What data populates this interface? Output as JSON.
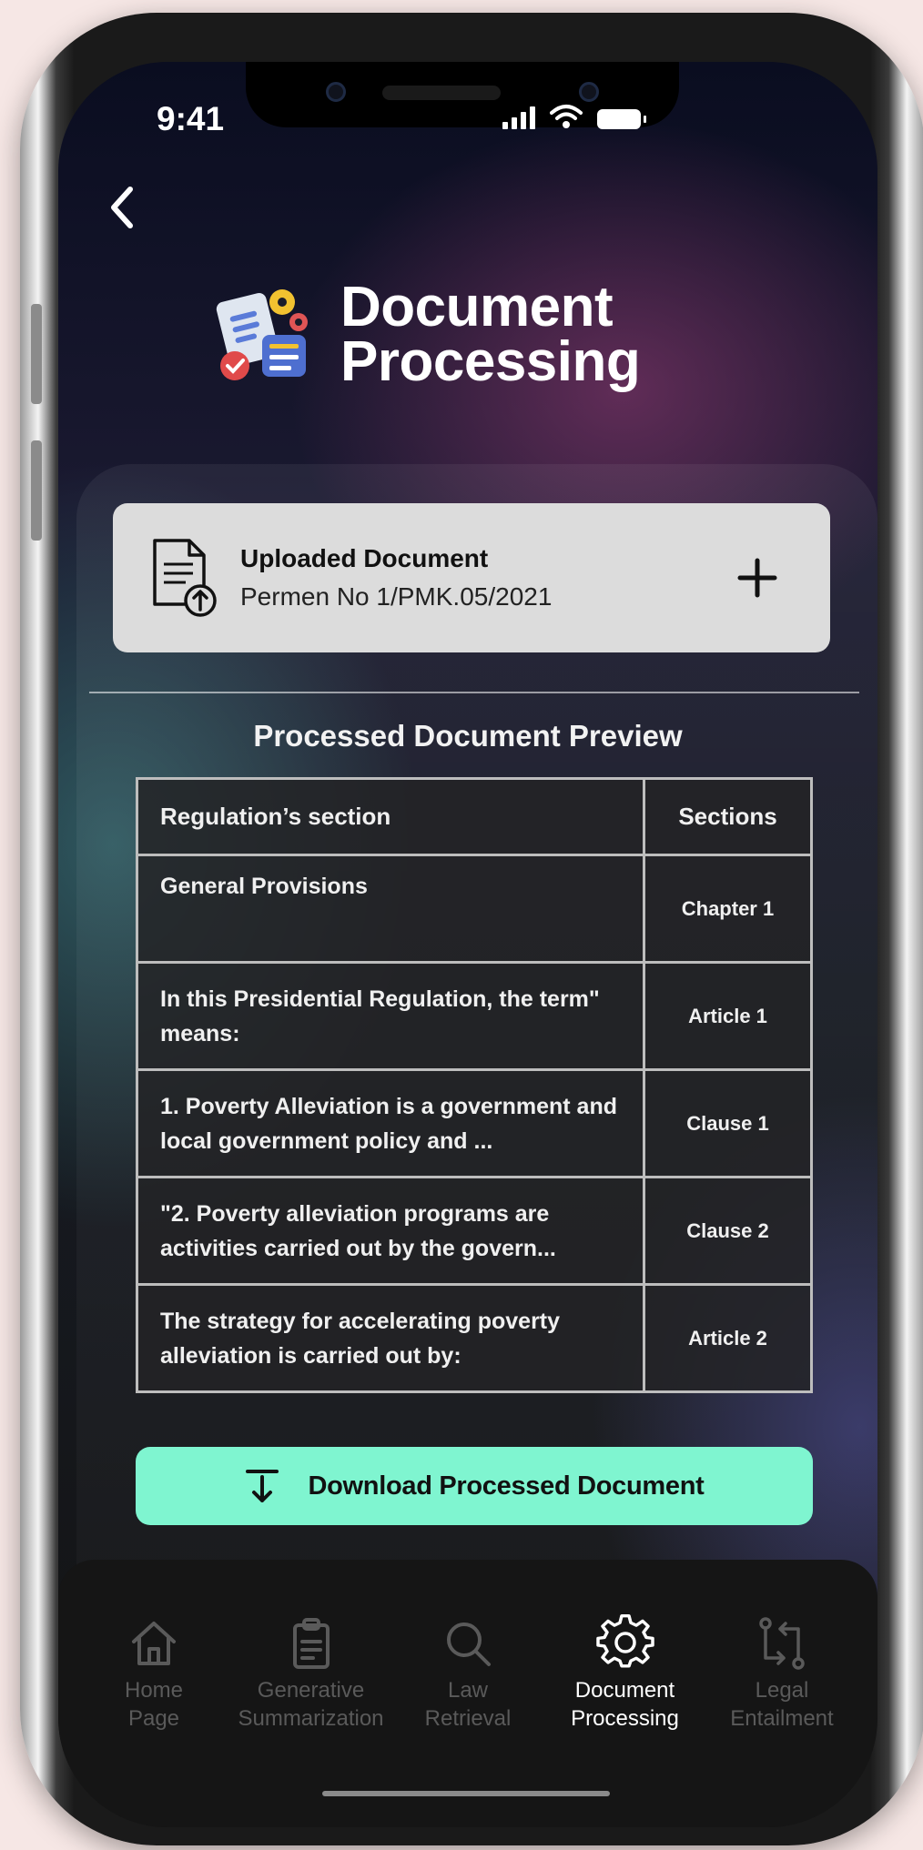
{
  "status_bar": {
    "time": "9:41"
  },
  "header": {
    "title_line1": "Document",
    "title_line2": "Processing"
  },
  "upload": {
    "title": "Uploaded Document",
    "document_name": "Permen No 1/PMK.05/2021"
  },
  "preview": {
    "title": "Processed Document Preview",
    "columns": [
      "Regulation’s section",
      "Sections"
    ],
    "rows": [
      {
        "text": "General Provisions",
        "section": "Chapter 1"
      },
      {
        "text": "In this Presidential Regulation, the term\" means:",
        "section": "Article 1"
      },
      {
        "text": "1. Poverty Alleviation is a government and local government policy and ...",
        "section": "Clause 1"
      },
      {
        "text": "\"2. Poverty alleviation programs are activities carried out by the govern...",
        "section": "Clause 2"
      },
      {
        "text": "The strategy for accelerating poverty alleviation is carried out by:",
        "section": "Article 2"
      }
    ]
  },
  "download": {
    "label": "Download Processed Document"
  },
  "tab_bar": {
    "tabs": [
      {
        "label_line1": "Home",
        "label_line2": "Page",
        "icon": "home-icon"
      },
      {
        "label_line1": "Generative",
        "label_line2": "Summarization",
        "icon": "clipboard-icon"
      },
      {
        "label_line1": "Law",
        "label_line2": "Retrieval",
        "icon": "search-icon"
      },
      {
        "label_line1": "Document",
        "label_line2": "Processing",
        "icon": "gear-icon",
        "active": true
      },
      {
        "label_line1": "Legal",
        "label_line2": "Entailment",
        "icon": "compare-arrows-icon"
      }
    ]
  },
  "colors": {
    "accent": "#7ff5d0",
    "card": "#dcdcdc",
    "background": "#f6e7e5"
  }
}
